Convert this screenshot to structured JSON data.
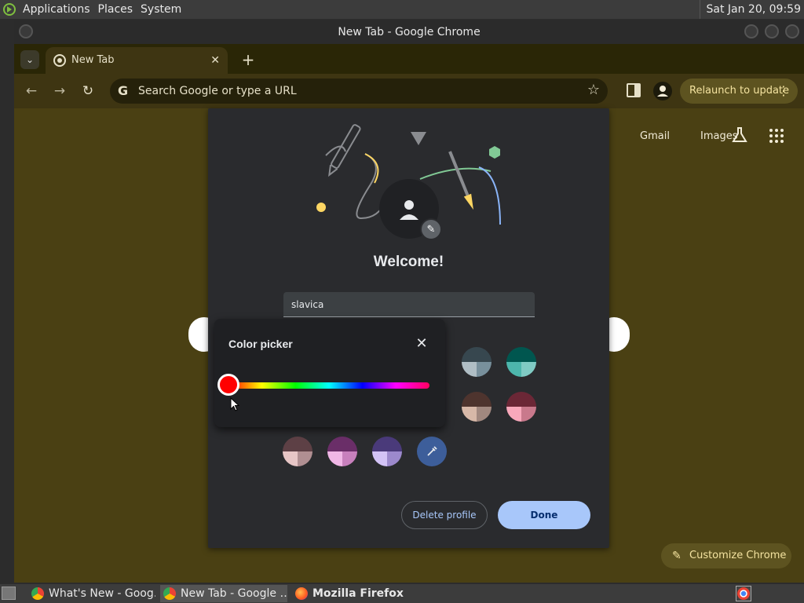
{
  "top_panel": {
    "menus": [
      "Applications",
      "Places",
      "System"
    ],
    "clock": "Sat Jan 20, 09:59"
  },
  "window": {
    "title": "New Tab - Google Chrome"
  },
  "tab": {
    "label": "New Tab"
  },
  "omnibox": {
    "placeholder": "Search Google or type a URL"
  },
  "toolbar": {
    "relaunch_label": "Relaunch to update"
  },
  "ntp": {
    "links": [
      "Gmail",
      "Images"
    ],
    "customize_label": "Customize Chrome"
  },
  "profile_dialog": {
    "welcome": "Welcome!",
    "name_value": "slavica",
    "delete_label": "Delete profile",
    "done_label": "Done",
    "swatches": [
      {
        "top": "#37474f",
        "bl": "#b0bec5",
        "br": "#78909c"
      },
      {
        "top": "#00564f",
        "bl": "#4db6ac",
        "br": "#80cbc4"
      },
      {
        "top": "#4e342e",
        "bl": "#d7b8a8",
        "br": "#a1887f"
      },
      {
        "top": "#6b2736",
        "bl": "#f8a8bb",
        "br": "#c9798c"
      },
      {
        "top": "#5d4045",
        "bl": "#e7c6c6",
        "br": "#b08f92"
      },
      {
        "top": "#6a2e68",
        "bl": "#f0b7e6",
        "br": "#c880bd"
      },
      {
        "top": "#4a3a7a",
        "bl": "#d3c3f6",
        "br": "#9c89cc"
      }
    ]
  },
  "color_picker": {
    "title": "Color picker",
    "selected_color": "#ff0000",
    "hue_position": 0
  },
  "taskbar": {
    "tasks": [
      "What's New - Goog…",
      "New Tab - Google …",
      "Mozilla Firefox"
    ]
  }
}
